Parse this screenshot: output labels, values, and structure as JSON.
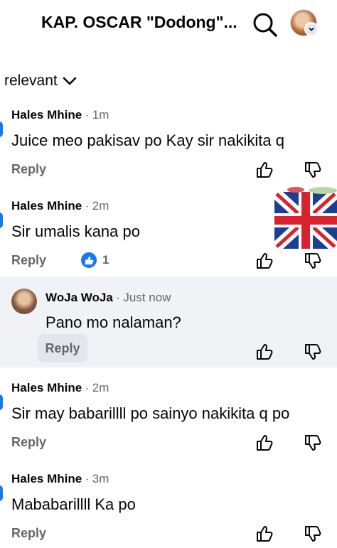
{
  "header": {
    "title": "KAP. OSCAR \"Dodong\"..."
  },
  "sort": {
    "label": "relevant"
  },
  "comments": [
    {
      "name": "Hales Mhine",
      "time": "1m",
      "text": "Juice meo pakisav po Kay sir nakikita q",
      "reply": "Reply"
    },
    {
      "name": "Hales Mhine",
      "time": "2m",
      "text": "Sir umalis kana po",
      "reply": "Reply",
      "reaction_count": "1"
    },
    {
      "name": "Hales Mhine",
      "time": "2m",
      "text": "Sir may babarillll po sainyo nakikita q po",
      "reply": "Reply"
    },
    {
      "name": "Hales Mhine",
      "time": "3m",
      "text": "Mababarillll Ka po",
      "reply": "Reply"
    }
  ],
  "reply_comment": {
    "name": "WoJa WoJa",
    "time": "Just now",
    "text": "Pano mo nalaman?",
    "reply": "Reply"
  },
  "separator": "·",
  "colors": {
    "accent": "#1877f2",
    "muted": "#65676b",
    "reply_bg": "#f0f2f5"
  },
  "icons": [
    "search-icon",
    "chevron-down-icon",
    "thumbs-up-icon",
    "thumbs-down-icon",
    "like-reaction-icon",
    "uk-flag-sticker"
  ]
}
